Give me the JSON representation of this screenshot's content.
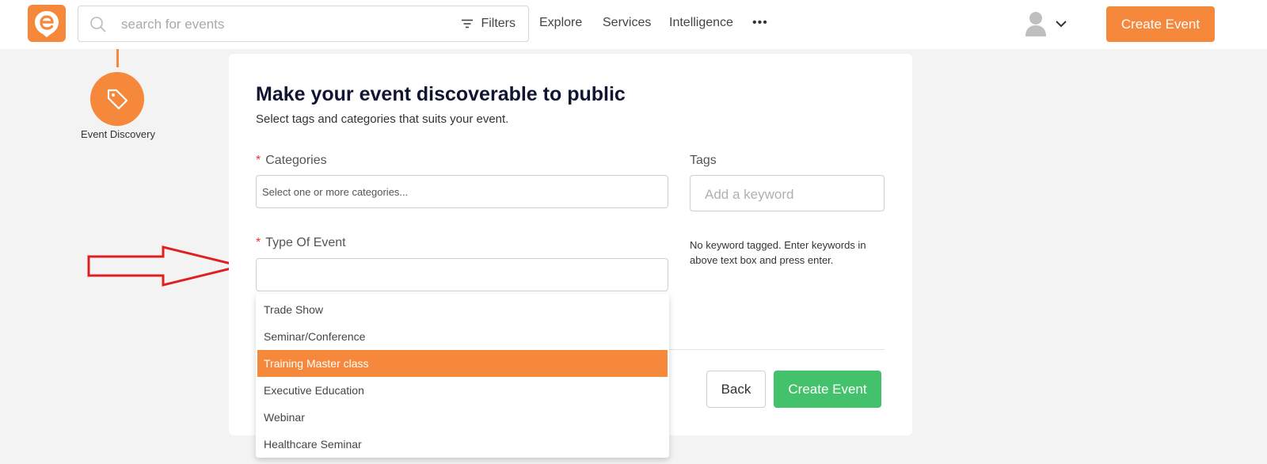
{
  "header": {
    "search_placeholder": "search for events",
    "filters_label": "Filters",
    "nav": [
      "Explore",
      "Services",
      "Intelligence"
    ],
    "more_label": "•••",
    "create_event_label": "Create Event"
  },
  "step": {
    "label": "Event Discovery",
    "icon": "tag-icon"
  },
  "form": {
    "title": "Make your event discoverable to public",
    "subtitle": "Select tags and categories that suits your event.",
    "categories_label": "Categories",
    "categories_placeholder": "Select one or more categories...",
    "tags_label": "Tags",
    "tags_placeholder": "Add a keyword",
    "tags_hint": "No keyword tagged. Enter keywords in above text box and press enter.",
    "type_label": "Type Of Event",
    "type_value": "",
    "required_mark": "*",
    "back_label": "Back",
    "create_label": "Create Event"
  },
  "dropdown": {
    "options": [
      "Trade Show",
      "Seminar/Conference",
      "Training Master class",
      "Executive Education",
      "Webinar",
      "Healthcare Seminar"
    ],
    "highlighted": "Training Master class"
  },
  "colors": {
    "brand": "#f5883b",
    "primary_button": "#43c26b",
    "annotation_arrow": "#e02020"
  }
}
